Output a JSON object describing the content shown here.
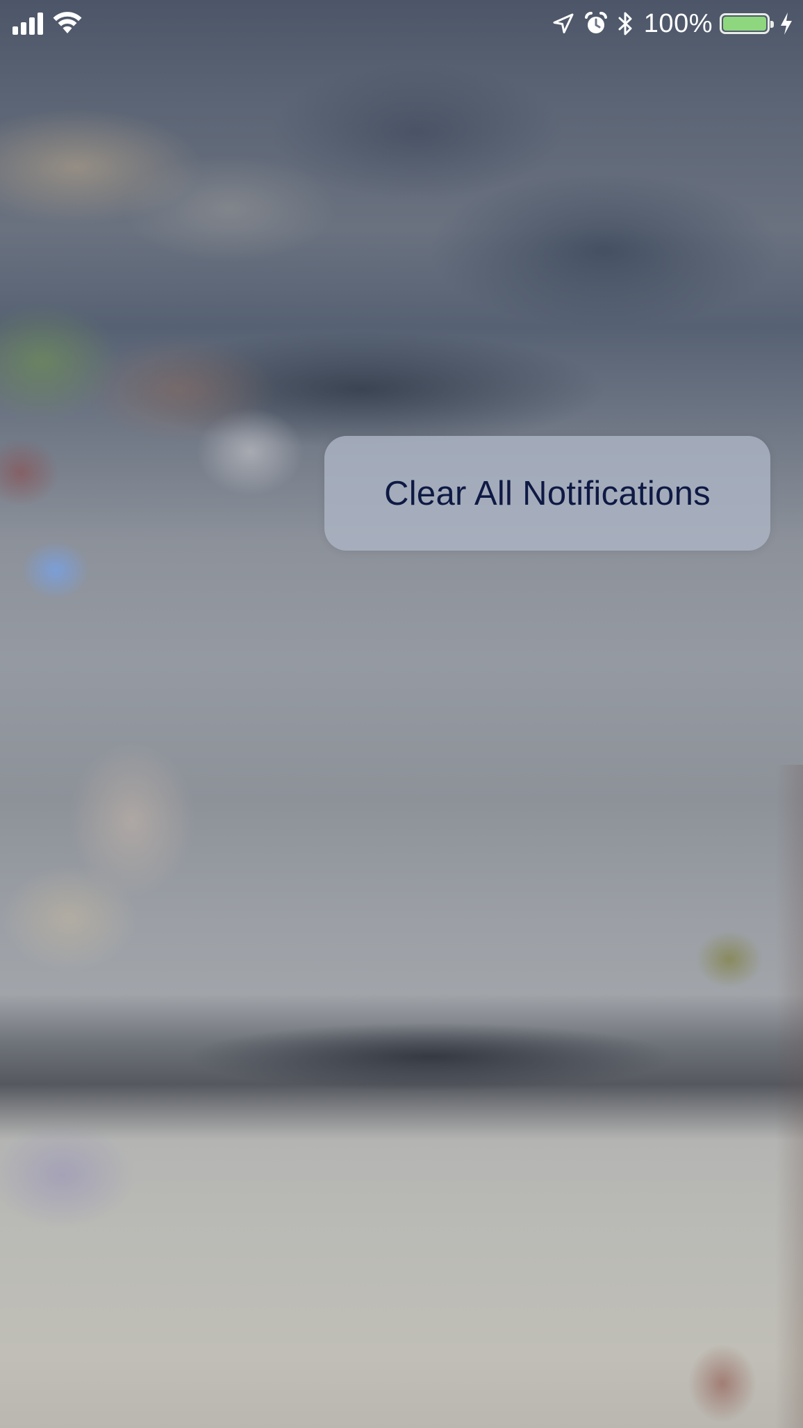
{
  "status_bar": {
    "signal_bars": 4,
    "wifi": "wifi-icon",
    "icons": [
      "location-arrow-icon",
      "alarm-clock-icon",
      "bluetooth-icon"
    ],
    "battery_percent": "100%",
    "battery_level": 1.0,
    "battery_color": "#8ed77e",
    "charging": "charging-bolt-icon"
  },
  "quick_action": {
    "label": "Clear All Notifications",
    "text_color": "#0e1a44"
  }
}
